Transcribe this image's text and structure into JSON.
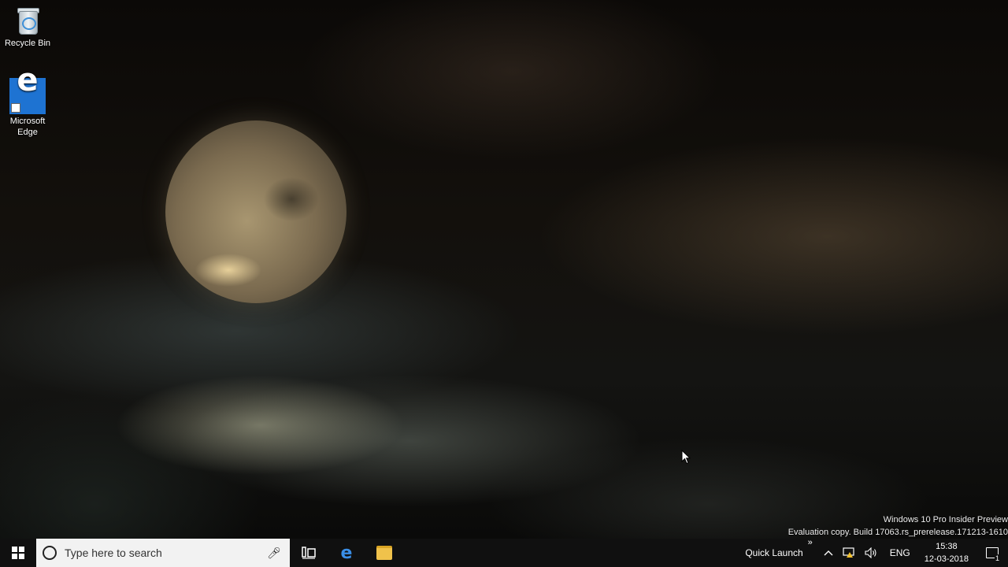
{
  "desktop": {
    "icons": [
      {
        "label": "Recycle Bin",
        "icon": "recycle-bin-icon"
      },
      {
        "label": "Microsoft Edge",
        "icon": "edge-icon"
      }
    ],
    "watermark": {
      "line1": "Windows 10 Pro Insider Preview",
      "line2": "Evaluation copy. Build 17063.rs_prerelease.171213-1610"
    }
  },
  "taskbar": {
    "search_placeholder": "Type here to search",
    "quick_launch": "Quick Launch",
    "quick_launch_chevron": "»",
    "language": "ENG",
    "time": "15:38",
    "date": "12-03-2018",
    "notification_count": "1"
  },
  "colors": {
    "taskbar": "#101010",
    "search_bg": "#f2f2f2",
    "edge_blue": "#1e73d2"
  }
}
